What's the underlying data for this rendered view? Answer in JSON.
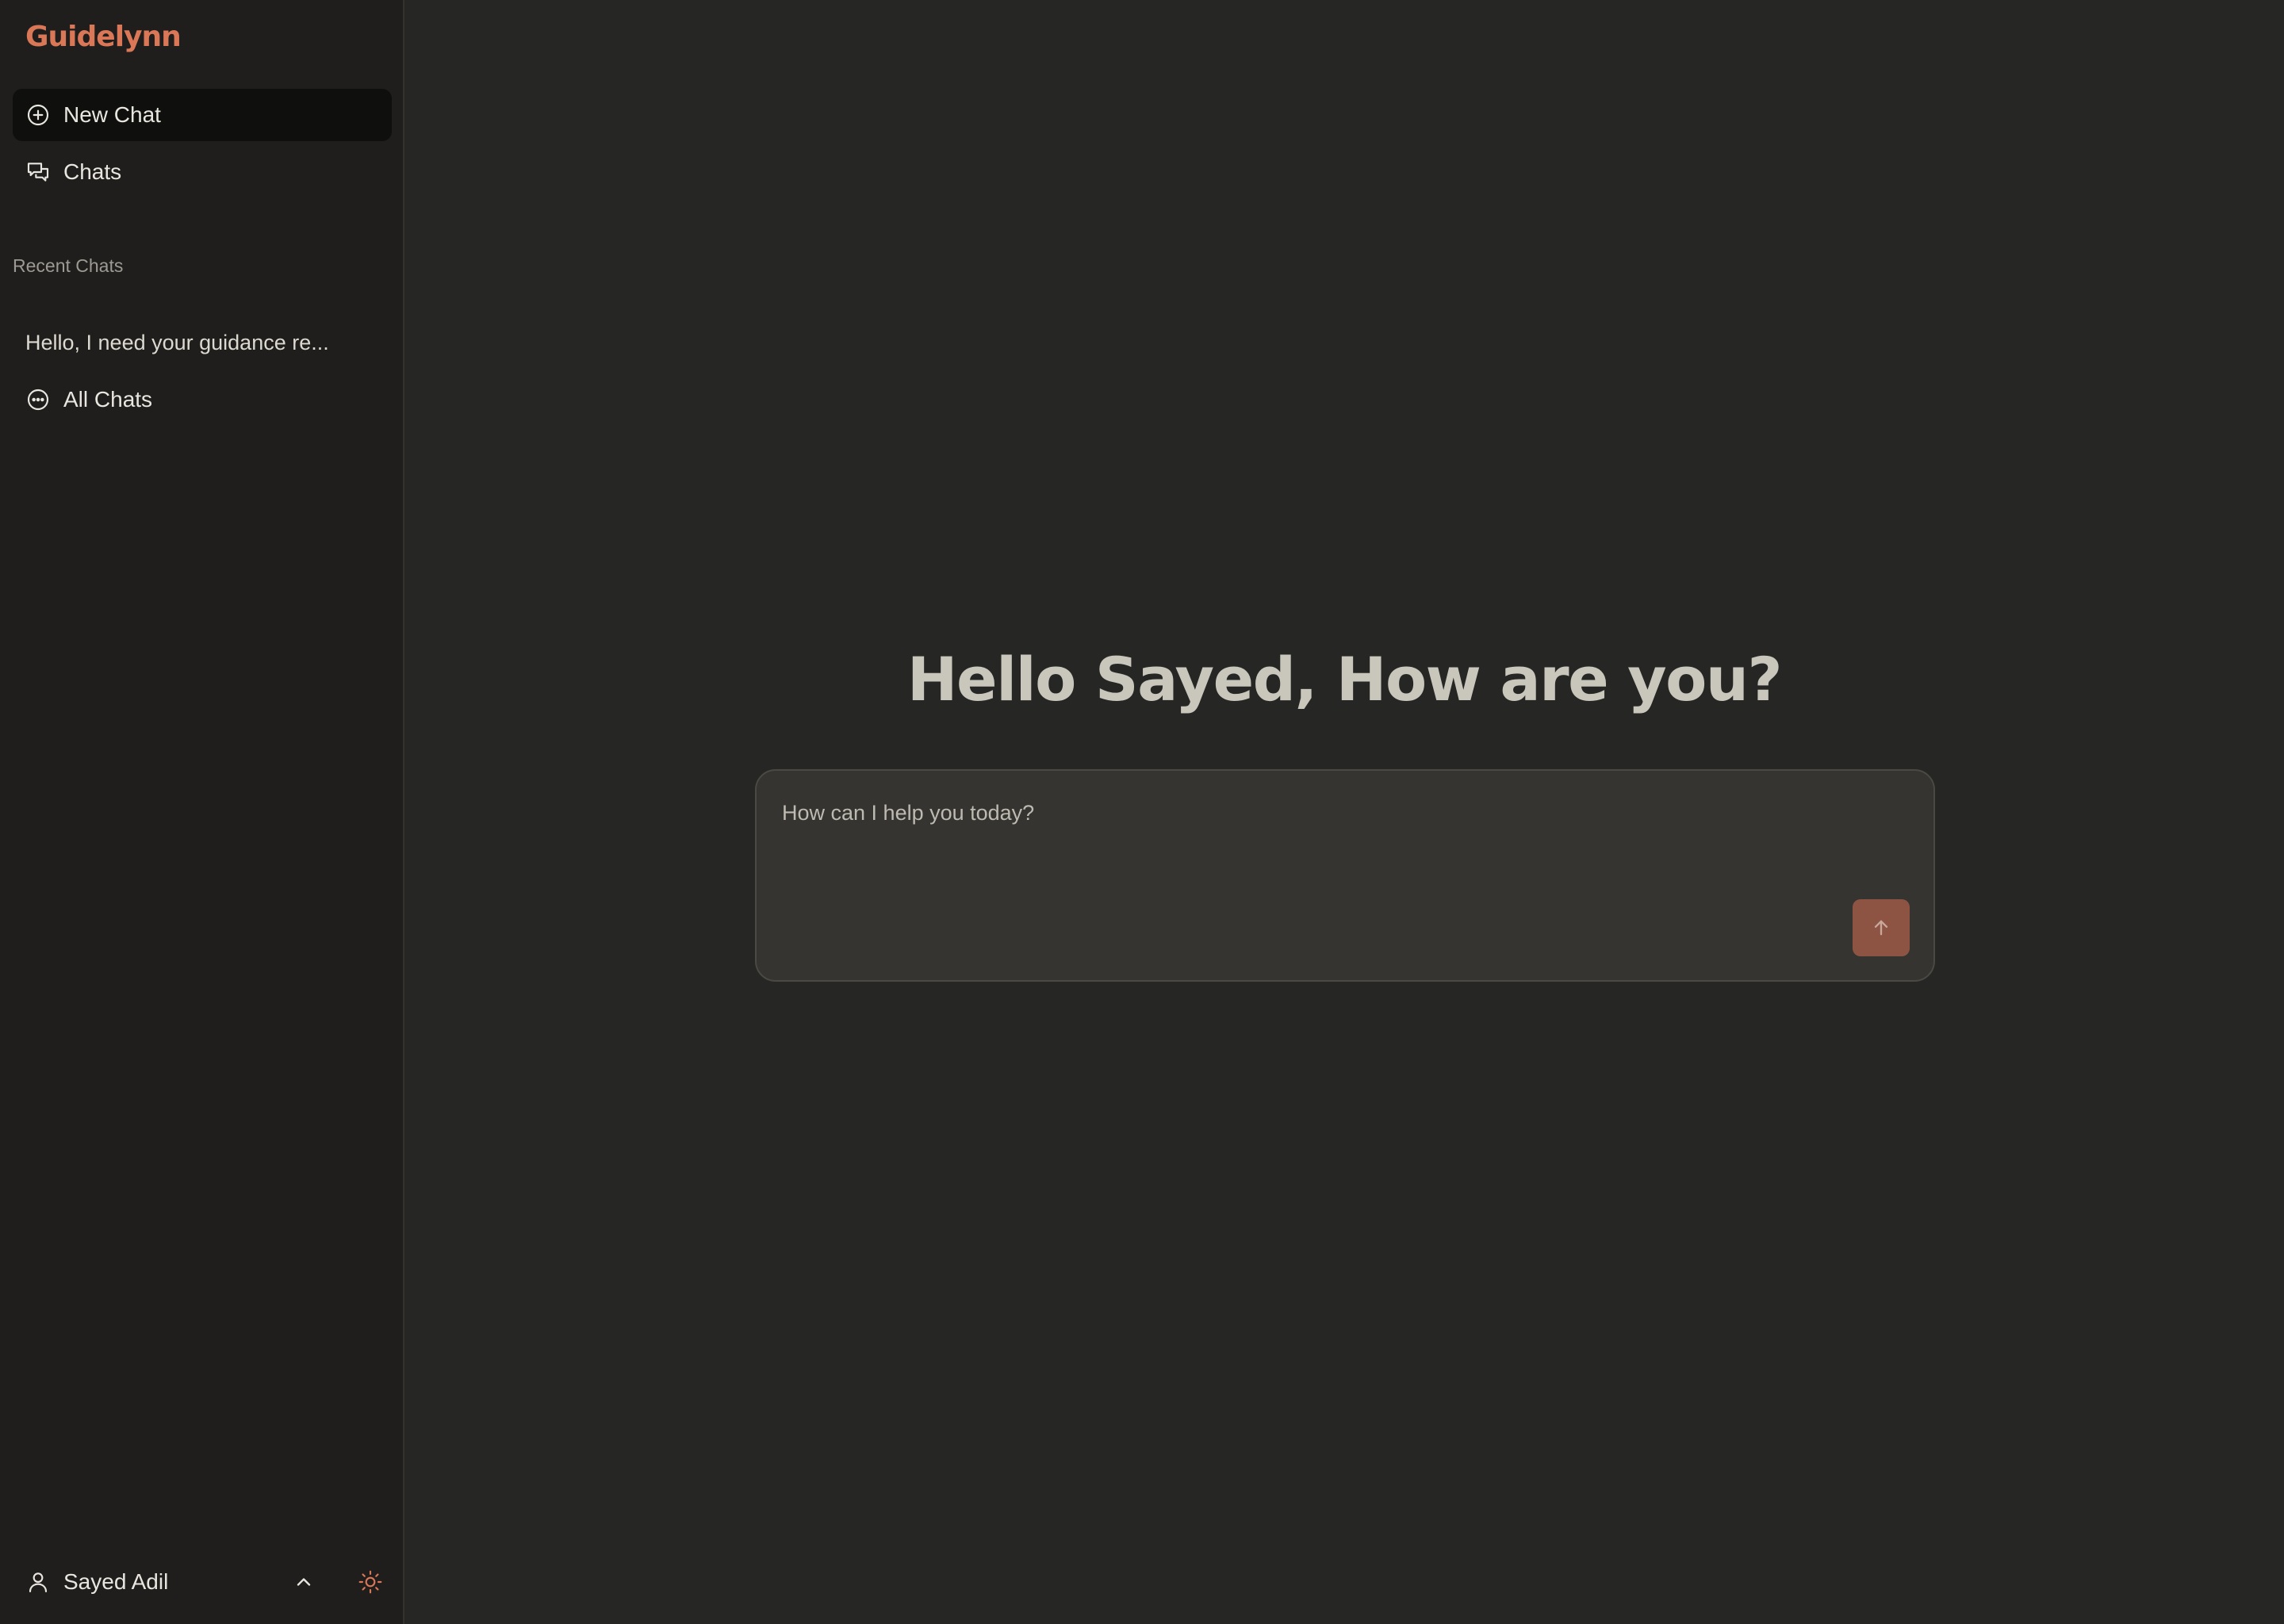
{
  "app": {
    "brand": "Guidelynn",
    "accent_color": "#d97757"
  },
  "sidebar": {
    "nav": [
      {
        "label": "New Chat",
        "icon": "plus-circle-icon",
        "active": true
      },
      {
        "label": "Chats",
        "icon": "chat-bubbles-icon",
        "active": false
      }
    ],
    "recent_label": "Recent Chats",
    "recent_chats": [
      {
        "title": "Hello, I need your guidance re..."
      }
    ],
    "all_chats": {
      "label": "All Chats",
      "icon": "more-circle-icon"
    },
    "user": {
      "name": "Sayed Adil",
      "icon": "user-icon",
      "menu_icon": "chevron-up-icon",
      "theme_icon": "sun-icon"
    }
  },
  "main": {
    "greeting": "Hello Sayed, How are you?",
    "composer": {
      "placeholder": "How can I help you today?",
      "value": "",
      "send_icon": "arrow-up-icon",
      "send_color": "#8e5443"
    }
  }
}
